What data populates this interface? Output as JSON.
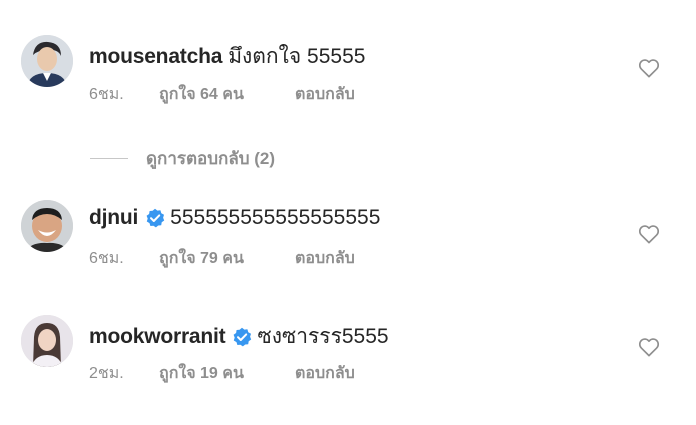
{
  "comments": [
    {
      "username": "mousenatcha",
      "verified": false,
      "text": "มึงตกใจ 55555",
      "time": "6ชม.",
      "likes": "ถูกใจ 64 คน",
      "reply": "ตอบกลับ",
      "avatar_icon": "user-avatar"
    },
    {
      "username": "djnui",
      "verified": true,
      "text": "555555555555555555",
      "time": "6ชม.",
      "likes": "ถูกใจ 79 คน",
      "reply": "ตอบกลับ",
      "avatar_icon": "user-avatar"
    },
    {
      "username": "mookworranit",
      "verified": true,
      "text": "ซงซารรร5555",
      "time": "2ชม.",
      "likes": "ถูกใจ 19 คน",
      "reply": "ตอบกลับ",
      "avatar_icon": "user-avatar"
    }
  ],
  "view_replies": "ดูการตอบกลับ (2)",
  "colors": {
    "text": "#262626",
    "secondary": "#8e8e8e",
    "verified": "#3897f0",
    "heart_outline": "#8e8e8e"
  },
  "icons": {
    "like": "heart-outline-icon",
    "verified": "verified-badge-icon"
  }
}
